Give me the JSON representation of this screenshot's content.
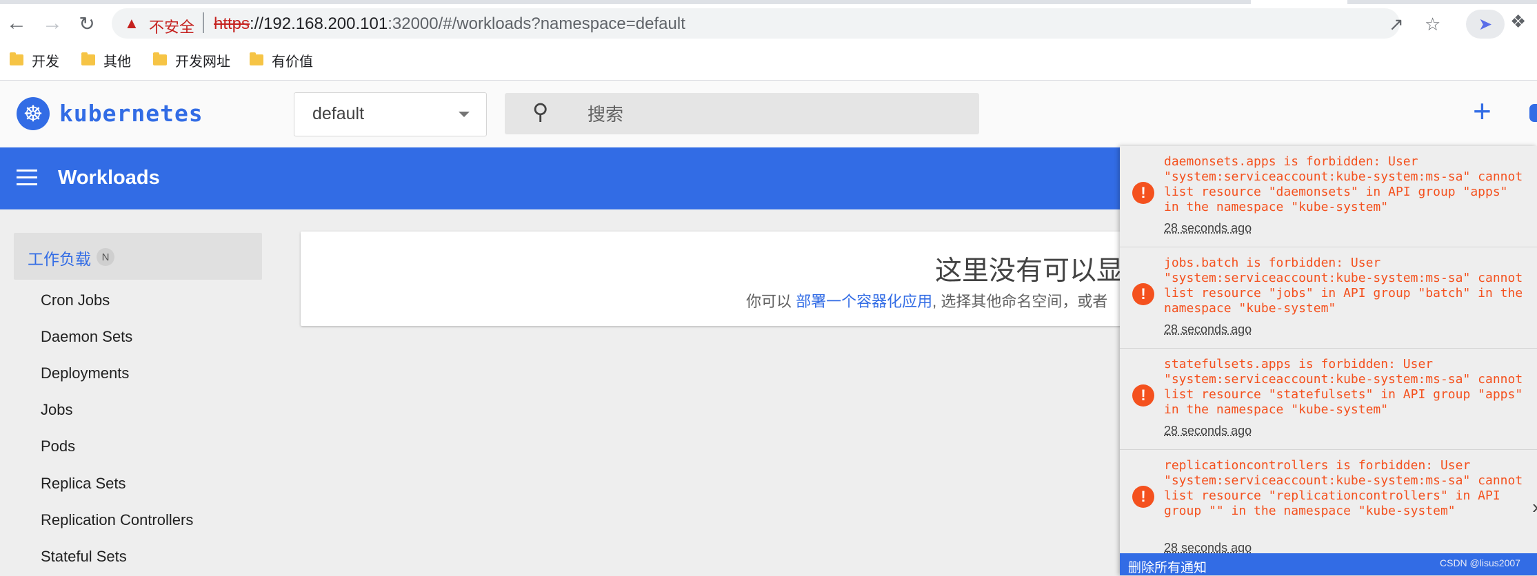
{
  "browser": {
    "insecure_label": "不安全",
    "url_scheme": "https",
    "url_host": "://192.168.200.101",
    "url_rest": ":32000/#/workloads?namespace=default",
    "bookmarks": [
      "开发",
      "其他",
      "开发网址",
      "有价值"
    ]
  },
  "header": {
    "brand": "kubernetes",
    "namespace": "default",
    "search_placeholder": "搜索",
    "create_label": "+"
  },
  "toolbar": {
    "title": "Workloads"
  },
  "sidebar": {
    "group_label": "工作负载",
    "group_badge": "N",
    "items": [
      {
        "label": "Cron Jobs"
      },
      {
        "label": "Daemon Sets"
      },
      {
        "label": "Deployments"
      },
      {
        "label": "Jobs"
      },
      {
        "label": "Pods"
      },
      {
        "label": "Replica Sets"
      },
      {
        "label": "Replication Controllers"
      },
      {
        "label": "Stateful Sets"
      }
    ]
  },
  "empty_state": {
    "title": "这里没有可以显",
    "prefix": "你可以 ",
    "link": "部署一个容器化应用",
    "suffix": ", 选择其他命名空间，或者"
  },
  "notifications": {
    "items": [
      {
        "message": "daemonsets.apps is forbidden: User \"system:serviceaccount:kube-system:ms-sa\" cannot list resource \"daemonsets\" in API group \"apps\" in the namespace \"kube-system\"",
        "time": "28 seconds ago"
      },
      {
        "message": "jobs.batch is forbidden: User \"system:serviceaccount:kube-system:ms-sa\" cannot list resource \"jobs\" in API group \"batch\" in the namespace \"kube-system\"",
        "time": "28 seconds ago"
      },
      {
        "message": "statefulsets.apps is forbidden: User \"system:serviceaccount:kube-system:ms-sa\" cannot list resource \"statefulsets\" in API group \"apps\" in the namespace \"kube-system\"",
        "time": "28 seconds ago"
      },
      {
        "message": "replicationcontrollers is forbidden: User \"system:serviceaccount:kube-system:ms-sa\" cannot list resource \"replicationcontrollers\" in API group \"\" in the namespace \"kube-system\"",
        "time": "28 seconds ago"
      }
    ],
    "clear_all_label": "删除所有通知"
  },
  "watermark": "CSDN @lisus2007",
  "colors": {
    "brand": "#326ce5",
    "error": "#f4511e",
    "insecure": "#c5221f"
  }
}
